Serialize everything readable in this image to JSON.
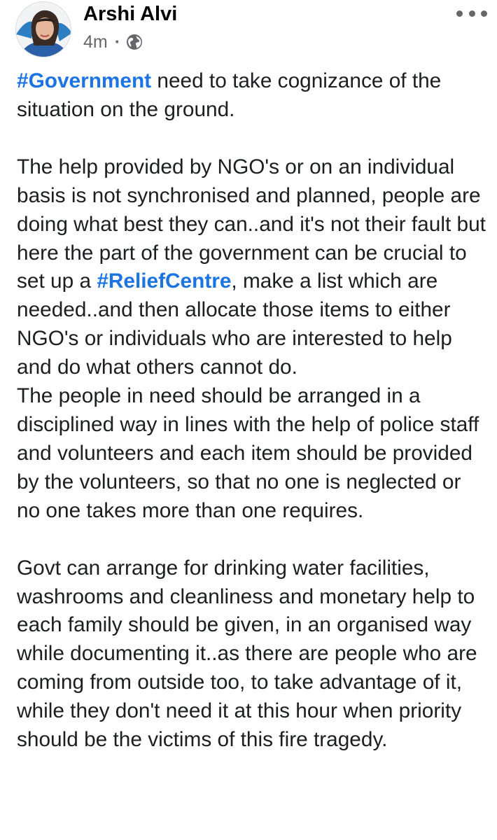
{
  "author": {
    "name": "Arshi Alvi",
    "timestamp": "4m",
    "separator": "·",
    "privacy_icon": "globe-icon"
  },
  "menu": {
    "icon": "more-options-icon"
  },
  "post": {
    "p1": {
      "hashtag": "#Government",
      "text": " need to take cognizance of the situation on the ground."
    },
    "p2": {
      "before": "The help provided by NGO's or on an individual basis is not synchronised and planned, people are doing what best they can..and it's not their fault but here the part of the government can be crucial to set up a ",
      "hashtag": "#ReliefCentre",
      "after": ", make a list which are needed..and then allocate those items to either NGO's or individuals who are interested to help and do what others cannot do."
    },
    "p3": "The people in need should be arranged in a disciplined way in lines with the help of police staff and volunteers and each item should be provided by the volunteers, so that no one is neglected or no one takes more than one requires.",
    "p4": "Govt can arrange for drinking water facilities, washrooms and cleanliness and monetary help to each family should be given, in an organised way while documenting it..as there are people who are coming from outside too, to take advantage of it, while they don't need it at this hour when priority should be the victims of this fire tragedy."
  },
  "colors": {
    "hashtag": "#1b74e4",
    "text": "#1c1e21",
    "secondary": "#65676b"
  }
}
